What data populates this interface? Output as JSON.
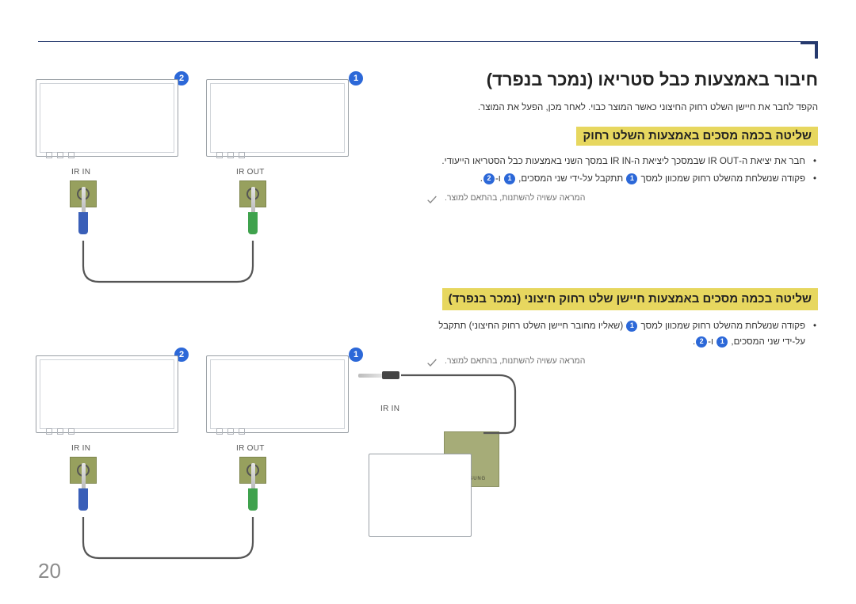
{
  "page_number": "20",
  "main_title": "חיבור באמצעות כבל סטריאו (נמכר בנפרד)",
  "intro": "הקפד לחבר את חיישן השלט רחוק החיצוני כאשר המוצר כבוי. לאחר מכן, הפעל את המוצר.",
  "section1": {
    "title": "שליטה בכמה מסכים באמצעות השלט רחוק",
    "bullets": [
      "חבר את יציאת ה-IR OUT שבמסכך ליציאת ה-IR IN במסך השני באמצעות כבל הסטריאו הייעודי.",
      "פקודה שנשלחת מהשלט רחוק שמכוון למסך 1 תתקבל על-ידי שני המסכים, 1 ו-2."
    ],
    "note": "המראה עשויה להשתנות, בהתאם למוצר."
  },
  "section2": {
    "title": "שליטה בכמה מסכים באמצעות חיישן שלט רחוק חיצוני (נמכר בנפרד)",
    "bullets": [
      "פקודה שנשלחת מהשלט רחוק שמכוון למסך 1 (שאליו מחובר חיישן השלט רחוק החיצוני) תתקבל על-ידי שני המסכים, 1 ו-2."
    ],
    "note": "המראה עשויה להשתנות, בהתאם למוצר."
  },
  "labels": {
    "ir_in": "IR IN",
    "ir_out": "IR OUT",
    "badge1": "1",
    "badge2": "2",
    "samsung": "SAMSUNG"
  }
}
